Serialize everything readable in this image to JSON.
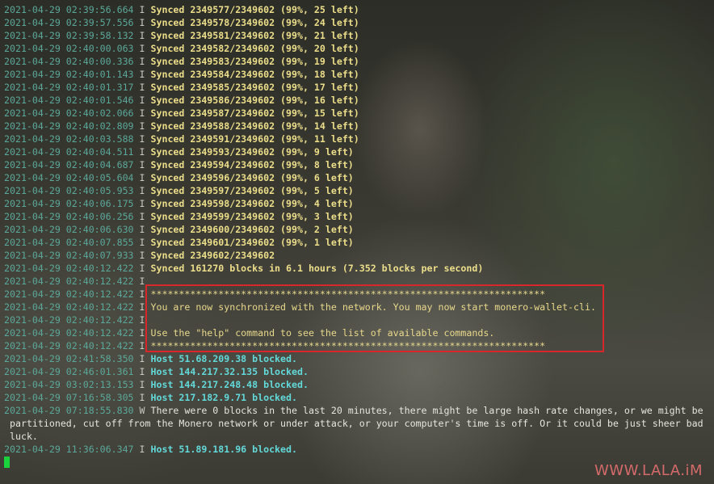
{
  "terminal": {
    "lines": [
      {
        "ts": "2021-04-29 02:39:56.664",
        "lvl": "I",
        "msg": "Synced 2349577/2349602 (99%, 25 left)",
        "kind": "sync"
      },
      {
        "ts": "2021-04-29 02:39:57.556",
        "lvl": "I",
        "msg": "Synced 2349578/2349602 (99%, 24 left)",
        "kind": "sync"
      },
      {
        "ts": "2021-04-29 02:39:58.132",
        "lvl": "I",
        "msg": "Synced 2349581/2349602 (99%, 21 left)",
        "kind": "sync"
      },
      {
        "ts": "2021-04-29 02:40:00.063",
        "lvl": "I",
        "msg": "Synced 2349582/2349602 (99%, 20 left)",
        "kind": "sync"
      },
      {
        "ts": "2021-04-29 02:40:00.336",
        "lvl": "I",
        "msg": "Synced 2349583/2349602 (99%, 19 left)",
        "kind": "sync"
      },
      {
        "ts": "2021-04-29 02:40:01.143",
        "lvl": "I",
        "msg": "Synced 2349584/2349602 (99%, 18 left)",
        "kind": "sync"
      },
      {
        "ts": "2021-04-29 02:40:01.317",
        "lvl": "I",
        "msg": "Synced 2349585/2349602 (99%, 17 left)",
        "kind": "sync"
      },
      {
        "ts": "2021-04-29 02:40:01.546",
        "lvl": "I",
        "msg": "Synced 2349586/2349602 (99%, 16 left)",
        "kind": "sync"
      },
      {
        "ts": "2021-04-29 02:40:02.066",
        "lvl": "I",
        "msg": "Synced 2349587/2349602 (99%, 15 left)",
        "kind": "sync"
      },
      {
        "ts": "2021-04-29 02:40:02.809",
        "lvl": "I",
        "msg": "Synced 2349588/2349602 (99%, 14 left)",
        "kind": "sync"
      },
      {
        "ts": "2021-04-29 02:40:03.588",
        "lvl": "I",
        "msg": "Synced 2349591/2349602 (99%, 11 left)",
        "kind": "sync"
      },
      {
        "ts": "2021-04-29 02:40:04.511",
        "lvl": "I",
        "msg": "Synced 2349593/2349602 (99%, 9 left)",
        "kind": "sync"
      },
      {
        "ts": "2021-04-29 02:40:04.687",
        "lvl": "I",
        "msg": "Synced 2349594/2349602 (99%, 8 left)",
        "kind": "sync"
      },
      {
        "ts": "2021-04-29 02:40:05.604",
        "lvl": "I",
        "msg": "Synced 2349596/2349602 (99%, 6 left)",
        "kind": "sync"
      },
      {
        "ts": "2021-04-29 02:40:05.953",
        "lvl": "I",
        "msg": "Synced 2349597/2349602 (99%, 5 left)",
        "kind": "sync"
      },
      {
        "ts": "2021-04-29 02:40:06.175",
        "lvl": "I",
        "msg": "Synced 2349598/2349602 (99%, 4 left)",
        "kind": "sync"
      },
      {
        "ts": "2021-04-29 02:40:06.256",
        "lvl": "I",
        "msg": "Synced 2349599/2349602 (99%, 3 left)",
        "kind": "sync"
      },
      {
        "ts": "2021-04-29 02:40:06.630",
        "lvl": "I",
        "msg": "Synced 2349600/2349602 (99%, 2 left)",
        "kind": "sync"
      },
      {
        "ts": "2021-04-29 02:40:07.855",
        "lvl": "I",
        "msg": "Synced 2349601/2349602 (99%, 1 left)",
        "kind": "sync"
      },
      {
        "ts": "2021-04-29 02:40:07.933",
        "lvl": "I",
        "msg": "Synced 2349602/2349602",
        "kind": "sync"
      },
      {
        "ts": "2021-04-29 02:40:12.422",
        "lvl": "I",
        "msg": "Synced 161270 blocks in 6.1 hours (7.352 blocks per second)",
        "kind": "sync"
      },
      {
        "ts": "2021-04-29 02:40:12.422",
        "lvl": "I",
        "msg": "",
        "kind": "box"
      },
      {
        "ts": "2021-04-29 02:40:12.422",
        "lvl": "I",
        "msg": "**********************************************************************",
        "kind": "box"
      },
      {
        "ts": "2021-04-29 02:40:12.422",
        "lvl": "I",
        "msg": "You are now synchronized with the network. You may now start monero-wallet-cli.",
        "kind": "box"
      },
      {
        "ts": "2021-04-29 02:40:12.422",
        "lvl": "I",
        "msg": "",
        "kind": "box"
      },
      {
        "ts": "2021-04-29 02:40:12.422",
        "lvl": "I",
        "msg": "Use the \"help\" command to see the list of available commands.",
        "kind": "box"
      },
      {
        "ts": "2021-04-29 02:40:12.422",
        "lvl": "I",
        "msg": "**********************************************************************",
        "kind": "box"
      },
      {
        "ts": "2021-04-29 02:41:58.350",
        "lvl": "I",
        "msg": "Host 51.68.209.38 blocked.",
        "kind": "host"
      },
      {
        "ts": "2021-04-29 02:46:01.361",
        "lvl": "I",
        "msg": "Host 144.217.32.135 blocked.",
        "kind": "host"
      },
      {
        "ts": "2021-04-29 03:02:13.153",
        "lvl": "I",
        "msg": "Host 144.217.248.48 blocked.",
        "kind": "host"
      },
      {
        "ts": "2021-04-29 07:16:58.305",
        "lvl": "I",
        "msg": "Host 217.182.9.71 blocked.",
        "kind": "host"
      },
      {
        "ts": "2021-04-29 07:18:55.830",
        "lvl": "W",
        "msg": "There were 0 blocks in the last 20 minutes, there might be large hash rate changes, or we might be",
        "kind": "warn"
      },
      {
        "ts": "",
        "lvl": "",
        "msg": "partitioned, cut off from the Monero network or under attack, or your computer's time is off. Or it could be just sheer bad",
        "kind": "wrap"
      },
      {
        "ts": "",
        "lvl": "",
        "msg": "luck.",
        "kind": "wrap"
      },
      {
        "ts": "2021-04-29 11:36:06.347",
        "lvl": "I",
        "msg": "Host 51.89.181.96 blocked.",
        "kind": "host"
      }
    ]
  },
  "watermark": "WWW.LALA.iM",
  "colors": {
    "timestamp": "#5ba89a",
    "sync": "#ecde8a",
    "host": "#62d8d8",
    "highlight_box": "#d8262a",
    "cursor": "#19d23c",
    "watermark": "#d46a6a"
  }
}
